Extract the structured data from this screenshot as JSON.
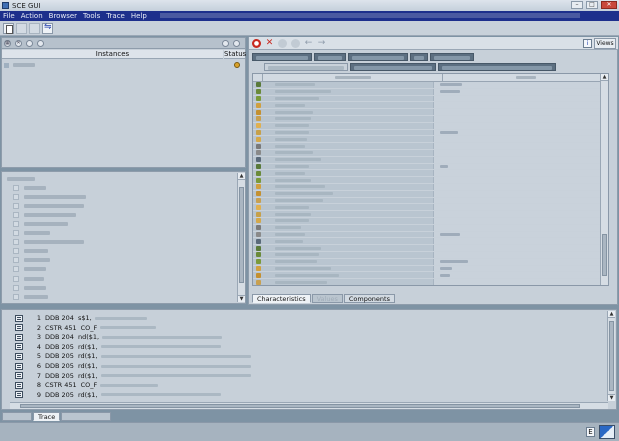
{
  "window": {
    "title": "SCE GUI"
  },
  "menu": [
    "File",
    "Action",
    "Browser",
    "Tools",
    "Trace",
    "Help"
  ],
  "instances": {
    "header_instances": "Instances",
    "header_status": "Status"
  },
  "characteristics_tabs": [
    "Characteristics",
    "Values",
    "Components"
  ],
  "trace": {
    "lines": [
      {
        "num": "1",
        "op": "DDB 204",
        "ref": "s$1,"
      },
      {
        "num": "2",
        "op": "CSTR 451",
        "ref": "CO_F"
      },
      {
        "num": "3",
        "op": "DDB 204",
        "ref": "nd($1,"
      },
      {
        "num": "4",
        "op": "DDB 205",
        "ref": "rd($1,"
      },
      {
        "num": "5",
        "op": "DDB 205",
        "ref": "rd($1,"
      },
      {
        "num": "6",
        "op": "DDB 205",
        "ref": "rd($1,"
      },
      {
        "num": "7",
        "op": "DDB 205",
        "ref": "rd($1,"
      },
      {
        "num": "8",
        "op": "CSTR 451",
        "ref": "CO_F"
      },
      {
        "num": "9",
        "op": "DDB 205",
        "ref": "rd($1,"
      }
    ]
  },
  "bottom_tabs": [
    "",
    "Trace",
    ""
  ],
  "status": {
    "e_label": "E"
  },
  "views_label": "Views",
  "colors": {
    "menubar": "#1d2f8c",
    "panel": "#c7d0d9",
    "background": "#7e93a4"
  }
}
